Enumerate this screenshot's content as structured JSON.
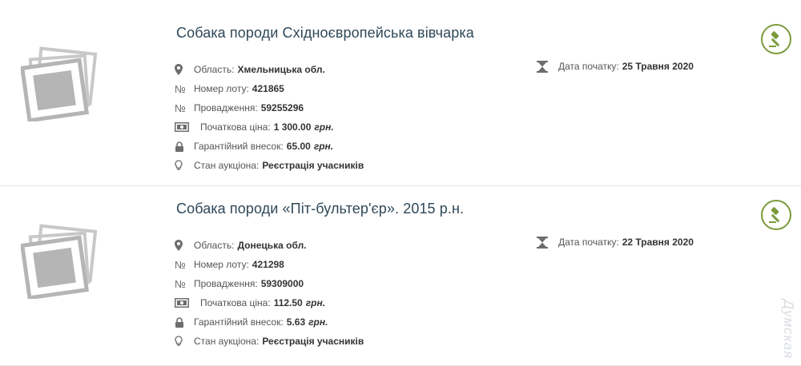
{
  "lots": [
    {
      "title": "Собака породи Східноєвропейська вівчарка",
      "region_label": "Область:",
      "region": "Хмельницька обл.",
      "lot_number_label": "Номер лоту:",
      "lot_number": "421865",
      "proceeding_label": "Провадження:",
      "proceeding": "59255296",
      "start_price_label": "Початкова ціна:",
      "start_price": "1 300.00",
      "start_price_currency": "грн.",
      "deposit_label": "Гарантійний внесок:",
      "deposit": "65.00",
      "deposit_currency": "грн.",
      "status_label": "Стан аукціона:",
      "status": "Реєстрація учасників",
      "start_date_label": "Дата початку:",
      "start_date": "25 Травня 2020",
      "icons": [
        "map-pin-icon",
        "number-sign-icon",
        "banknote-icon",
        "lock-icon",
        "lightbulb-icon",
        "hourglass-icon",
        "gavel-icon",
        "photo-placeholder-icon"
      ]
    },
    {
      "title": "Собака породи «Піт-бультер'єр». 2015 р.н.",
      "region_label": "Область:",
      "region": "Донецька обл.",
      "lot_number_label": "Номер лоту:",
      "lot_number": "421298",
      "proceeding_label": "Провадження:",
      "proceeding": "59309000",
      "start_price_label": "Початкова ціна:",
      "start_price": "112.50",
      "start_price_currency": "грн.",
      "deposit_label": "Гарантійний внесок:",
      "deposit": "5.63",
      "deposit_currency": "грн.",
      "status_label": "Стан аукціона:",
      "status": "Реєстрація учасників",
      "start_date_label": "Дата початку:",
      "start_date": "22 Травня 2020"
    }
  ],
  "watermark": "Думская",
  "colors": {
    "title": "#2f4858",
    "gavel_accent": "#7c9a3c",
    "icon": "#6d6d6d",
    "divider": "#e3e3e3"
  }
}
